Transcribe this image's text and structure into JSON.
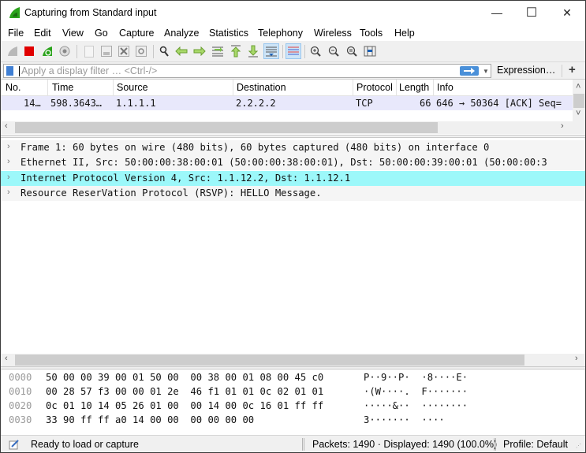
{
  "window": {
    "title": "Capturing from Standard input",
    "controls": {
      "minimize": "—",
      "maximize": "☐",
      "close": "✕"
    }
  },
  "menu": [
    "File",
    "Edit",
    "View",
    "Go",
    "Capture",
    "Analyze",
    "Statistics",
    "Telephony",
    "Wireless",
    "Tools",
    "Help"
  ],
  "toolbar": {
    "icons": [
      "start-capture-icon",
      "stop-capture-icon",
      "restart-capture-icon",
      "capture-options-icon",
      "open-file-icon",
      "save-file-icon",
      "close-file-icon",
      "reload-file-icon",
      "find-packet-icon",
      "go-back-icon",
      "go-forward-icon",
      "go-to-packet-icon",
      "go-first-icon",
      "go-last-icon",
      "autoscroll-icon",
      "colorize-icon",
      "zoom-in-icon",
      "zoom-out-icon",
      "zoom-normal-icon",
      "resize-columns-icon"
    ],
    "active": [
      "autoscroll-icon",
      "colorize-icon"
    ]
  },
  "filter": {
    "placeholder": "Apply a display filter … <Ctrl-/>",
    "value": "",
    "expression_label": "Expression…",
    "add_label": "+"
  },
  "packet_list": {
    "columns": [
      "No.",
      "Time",
      "Source",
      "Destination",
      "Protocol",
      "Length",
      "Info"
    ],
    "rows": [
      {
        "no": "14…",
        "time": "598.3643…",
        "source": "1.1.1.1",
        "destination": "2.2.2.2",
        "protocol": "TCP",
        "length": "66",
        "info": "646 → 50364 [ACK] Seq="
      }
    ]
  },
  "details": [
    {
      "text": "Frame 1: 60 bytes on wire (480 bits), 60 bytes captured (480 bits) on interface 0",
      "selected": false
    },
    {
      "text": "Ethernet II, Src: 50:00:00:38:00:01 (50:00:00:38:00:01), Dst: 50:00:00:39:00:01 (50:00:00:3",
      "selected": false
    },
    {
      "text": "Internet Protocol Version 4, Src: 1.1.12.2, Dst: 1.1.12.1",
      "selected": true
    },
    {
      "text": "Resource ReserVation Protocol (RSVP): HELLO Message.",
      "selected": false
    }
  ],
  "bytes": [
    {
      "offset": "0000",
      "hex": "50 00 00 39 00 01 50 00  00 38 00 01 08 00 45 c0",
      "ascii": "P··9··P·  ·8····E·"
    },
    {
      "offset": "0010",
      "hex": "00 28 57 f3 00 00 01 2e  46 f1 01 01 0c 02 01 01",
      "ascii": "·(W····.  F·······"
    },
    {
      "offset": "0020",
      "hex": "0c 01 10 14 05 26 01 00  00 14 00 0c 16 01 ff ff",
      "ascii": "·····&··  ········"
    },
    {
      "offset": "0030",
      "hex": "33 90 ff ff a0 14 00 00  00 00 00 00",
      "ascii": "3·······  ····"
    }
  ],
  "status": {
    "ready": "Ready to load or capture",
    "packets": "Packets: 1490 · Displayed: 1490 (100.0%)",
    "profile": "Profile: Default"
  },
  "colors": {
    "selected_detail": "#9cf8fa",
    "packet_row": "#e8e8fb",
    "accent": "#4a90d9"
  }
}
